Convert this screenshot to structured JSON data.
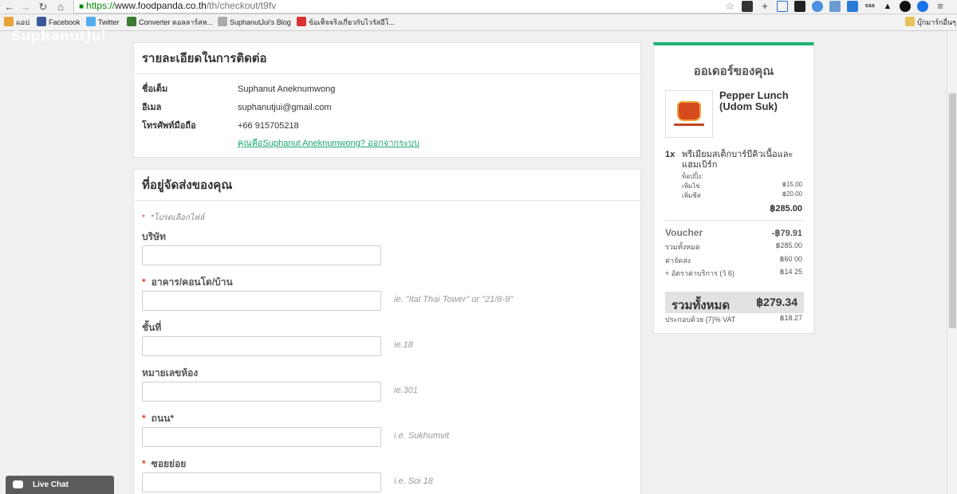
{
  "browser": {
    "url_scheme": "https://",
    "url_host": "www.foodpanda.co.th",
    "url_path": "/th/checkout/t9fv",
    "bookmarks": [
      "แอป",
      "Facebook",
      "Twitter",
      "Converter ดอลลาร์สห...",
      "SuphanutJui's Blog",
      "ข้อเท็จจริงเกี่ยวกับไวรัสอีโ...",
      "บุ๊กมาร์กอื่นๆ"
    ],
    "watermark": "SuphanutJui"
  },
  "contact": {
    "title": "รายละเอียดในการติดต่อ",
    "rows": [
      {
        "label": "ชื่อเต็ม",
        "value": "Suphanut Aneknumwong"
      },
      {
        "label": "อีเมล",
        "value": "suphanutjui@gmail.com"
      },
      {
        "label": "โทรศัพท์มือถือ",
        "value": "+66 915705218"
      }
    ],
    "logout_link": "คุณคือSuphanut Aneknumwong? ออกจากระบบ"
  },
  "address": {
    "title": "ที่อยู่จัดส่งของคุณ",
    "required_note": "*โปรดเลือกไฟล์",
    "fields": [
      {
        "label": "บริษัท",
        "required": false,
        "hint": ""
      },
      {
        "label": "อาคาร/คอนโด/บ้าน",
        "required": true,
        "hint": "ie. \"Ital Thai Tower\" or \"21/8-9\""
      },
      {
        "label": "ชั้นที่",
        "required": false,
        "hint": "ie.18"
      },
      {
        "label": "หมายเลขห้อง",
        "required": false,
        "hint": "ie.301"
      },
      {
        "label": "ถนน*",
        "required": true,
        "hint": "i.e. Sukhumvit"
      },
      {
        "label": "ซอยย่อย",
        "required": true,
        "hint": "i.e. Soi 18"
      }
    ]
  },
  "order": {
    "title": "ออเดอร์ของคุณ",
    "restaurant": "Pepper Lunch (Udom Suk)",
    "item": {
      "qty": "1x",
      "name": "พรีเมียมสเต็กบาร์บีคิวเนื้อและแฮมเบิร์ก",
      "options_heading": "ท็อปปิ้ง:",
      "options": [
        {
          "name": "เพิ่มไข่",
          "price": "฿15.00"
        },
        {
          "name": "เพิ่มชีส",
          "price": "฿20.00"
        }
      ],
      "total": "฿285.00"
    },
    "voucher_label": "Voucher",
    "voucher_value": "-฿79.91",
    "summary": [
      {
        "label": "รวมทั้งหมด",
        "value": "฿285.00"
      },
      {
        "label": "ค่าจัดส่ง",
        "value": "฿60 00"
      },
      {
        "label": "+ อัตราค่าบริการ (วั 6)",
        "value": "฿14 25"
      }
    ],
    "grand_label": "รวมทั้งหมด",
    "grand_value": "฿279.34",
    "vat_label": "ประกอบด้วย {7}% VAT",
    "vat_value": "฿18.27"
  },
  "livechat": {
    "label": "Live Chat"
  },
  "colors": {
    "accent": "#1fb378",
    "required": "#e53935",
    "link": "#1aa66a"
  }
}
